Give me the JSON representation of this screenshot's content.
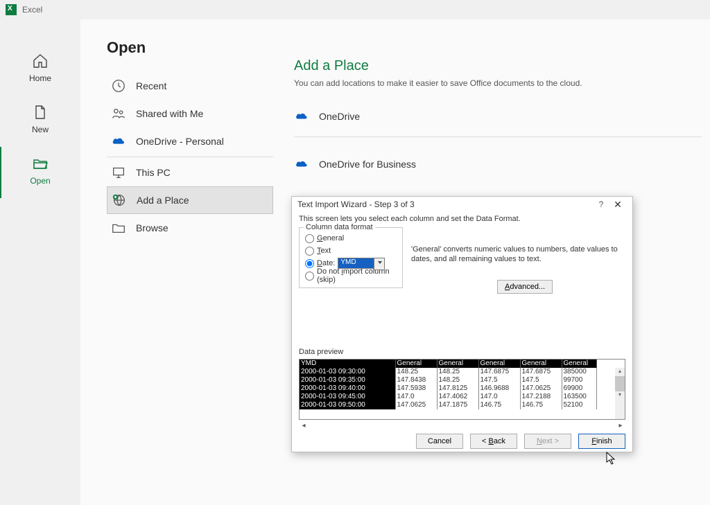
{
  "app": {
    "name": "Excel"
  },
  "nav": {
    "home": "Home",
    "new": "New",
    "open": "Open"
  },
  "page": {
    "title": "Open"
  },
  "open_locations": {
    "recent": "Recent",
    "shared": "Shared with Me",
    "onedrive_personal": "OneDrive - Personal",
    "this_pc": "This PC",
    "add_place": "Add a Place",
    "browse": "Browse"
  },
  "add_place_panel": {
    "heading": "Add a Place",
    "subtitle": "You can add locations to make it easier to save Office documents to the cloud.",
    "onedrive": "OneDrive",
    "onedrive_business": "OneDrive for Business"
  },
  "dialog": {
    "title": "Text Import Wizard - Step 3 of 3",
    "help_symbol": "?",
    "close_symbol": "✕",
    "instruction": "This screen lets you select each column and set the Data Format.",
    "group_title": "Column data format",
    "radio_general": "General",
    "radio_text": "Text",
    "radio_date": "Date:",
    "date_format_selected": "YMD",
    "radio_skip": "Do not import column (skip)",
    "explain": "'General' converts numeric values to numbers, date values to dates, and all remaining values to text.",
    "advanced": "Advanced...",
    "preview_label": "Data preview",
    "buttons": {
      "cancel": "Cancel",
      "back": "< Back",
      "next": "Next >",
      "finish": "Finish"
    },
    "preview": {
      "headers": [
        "YMD",
        "General",
        "General",
        "General",
        "General",
        "General"
      ],
      "rows": [
        [
          "2000-01-03 09:30:00",
          "148.25",
          "148.25",
          "147.6875",
          "147.6875",
          "385000"
        ],
        [
          "2000-01-03 09:35:00",
          "147.8438",
          "148.25",
          "147.5",
          "147.5",
          "99700"
        ],
        [
          "2000-01-03 09:40:00",
          "147.5938",
          "147.8125",
          "146.9688",
          "147.0625",
          "69900"
        ],
        [
          "2000-01-03 09:45:00",
          "147.0",
          "147.4062",
          "147.0",
          "147.2188",
          "163500"
        ],
        [
          "2000-01-03 09:50:00",
          "147.0625",
          "147.1875",
          "146.75",
          "146.75",
          "52100"
        ]
      ]
    }
  }
}
